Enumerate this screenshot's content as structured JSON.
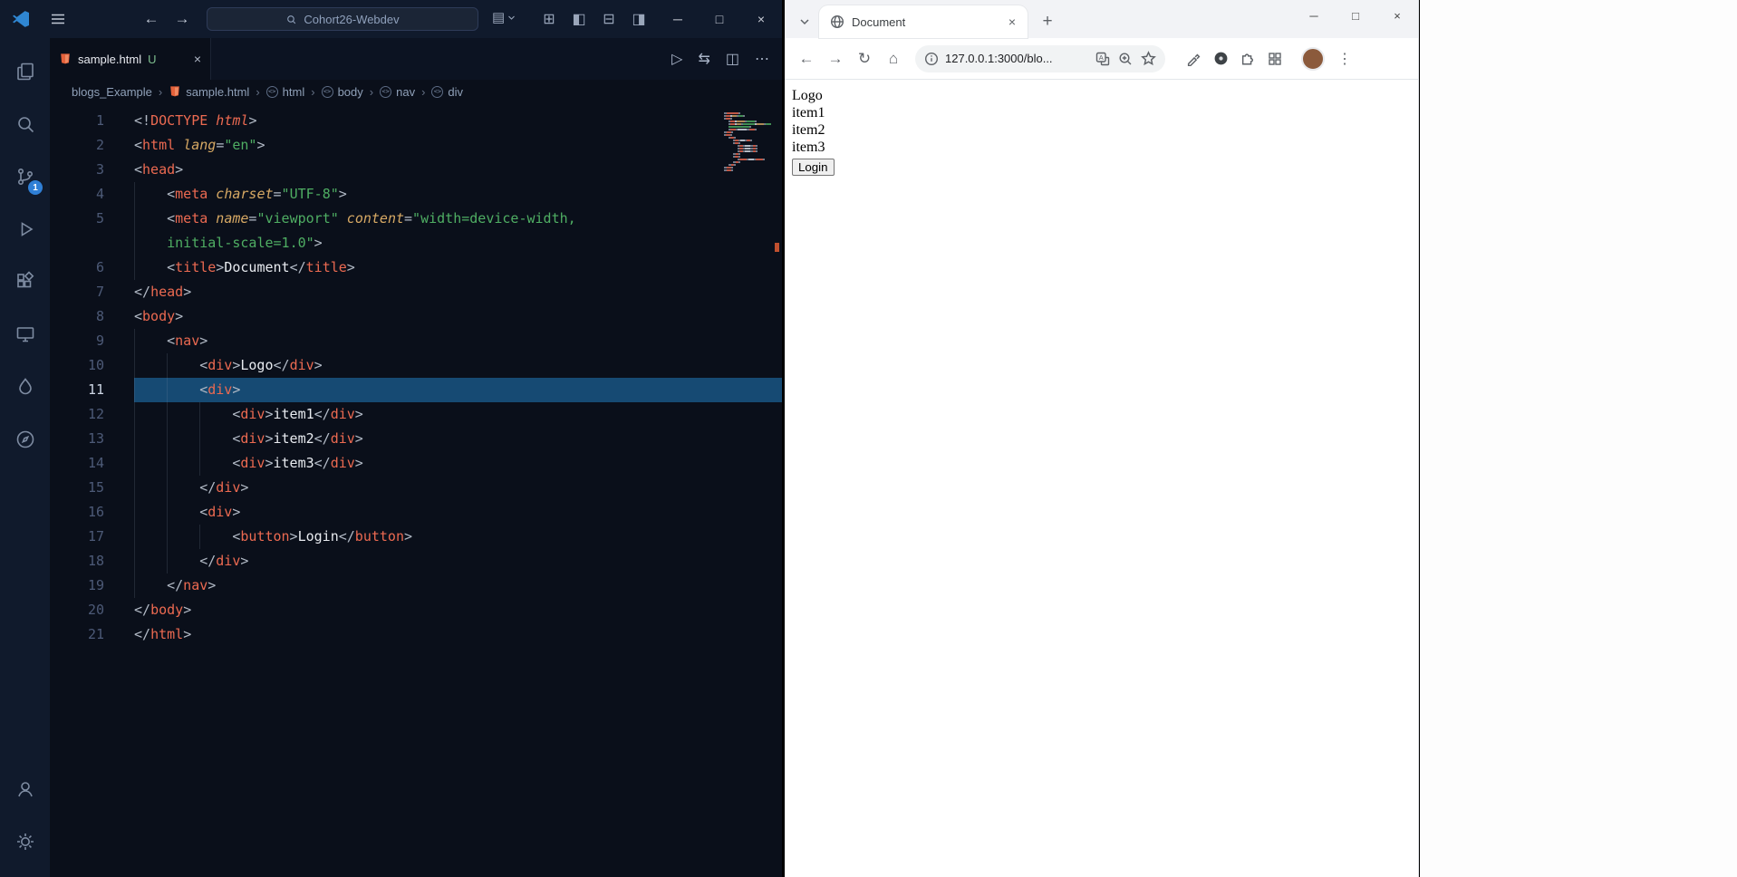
{
  "icons": {
    "play": "▷",
    "diff": "⇆",
    "split_editor": "◫",
    "more": "⋯",
    "minimize": "─",
    "maximize": "□",
    "close": "×",
    "back": "←",
    "forward": "→",
    "reload": "↻",
    "home": "⌂",
    "new_tab": "+",
    "menu_dots": "⋮",
    "grid_layout": "⊞",
    "panel_left": "◧",
    "panel_bottom": "⊟",
    "panel_right": "◨",
    "customize_layout": "▤",
    "breadcrumb_sep": "›"
  },
  "colors": {
    "accent_blue": "#2f86d2",
    "html_icon_orange": "#e5623b",
    "active_line_highlight": "#164a73",
    "tag": "#ec6a51",
    "attribute": "#d7a964",
    "string": "#4fae63",
    "badge_blue": "#2f7fd6"
  },
  "vscode": {
    "titlebar": {
      "search_placeholder": "Cohort26-Webdev"
    },
    "activitybar": {
      "source_control_badge": "1"
    },
    "tabs": [
      {
        "label": "sample.html",
        "status": "U"
      }
    ],
    "breadcrumb": [
      "blogs_Example",
      "sample.html",
      "html",
      "body",
      "nav",
      "div"
    ],
    "editor": {
      "active_line": 11,
      "lines": [
        {
          "n": "1",
          "ind": 0,
          "t": [
            [
              "p",
              "<!"
            ],
            [
              "t",
              "DOCTYPE"
            ],
            [
              "ti",
              " html"
            ],
            [
              "p",
              ">"
            ]
          ]
        },
        {
          "n": "2",
          "ind": 0,
          "t": [
            [
              "p",
              "<"
            ],
            [
              "t",
              "html"
            ],
            [
              "x",
              " "
            ],
            [
              "a",
              "lang"
            ],
            [
              "p",
              "="
            ],
            [
              "s",
              "\"en\""
            ],
            [
              "p",
              ">"
            ]
          ]
        },
        {
          "n": "3",
          "ind": 0,
          "t": [
            [
              "p",
              "<"
            ],
            [
              "t",
              "head"
            ],
            [
              "p",
              ">"
            ]
          ]
        },
        {
          "n": "4",
          "ind": 1,
          "t": [
            [
              "p",
              "<"
            ],
            [
              "t",
              "meta"
            ],
            [
              "x",
              " "
            ],
            [
              "a",
              "charset"
            ],
            [
              "p",
              "="
            ],
            [
              "s",
              "\"UTF-8\""
            ],
            [
              "p",
              ">"
            ]
          ]
        },
        {
          "n": "5",
          "ind": 1,
          "t": [
            [
              "p",
              "<"
            ],
            [
              "t",
              "meta"
            ],
            [
              "x",
              " "
            ],
            [
              "a",
              "name"
            ],
            [
              "p",
              "="
            ],
            [
              "s",
              "\"viewport\""
            ],
            [
              "x",
              " "
            ],
            [
              "a",
              "content"
            ],
            [
              "p",
              "="
            ],
            [
              "s",
              "\"width=device-width,"
            ]
          ]
        },
        {
          "n": "",
          "ind": 1,
          "t": [
            [
              "s",
              "initial-scale=1.0\""
            ],
            [
              "p",
              ">"
            ]
          ]
        },
        {
          "n": "6",
          "ind": 1,
          "t": [
            [
              "p",
              "<"
            ],
            [
              "t",
              "title"
            ],
            [
              "p",
              ">"
            ],
            [
              "x",
              "Document"
            ],
            [
              "p",
              "</"
            ],
            [
              "t",
              "title"
            ],
            [
              "p",
              ">"
            ]
          ]
        },
        {
          "n": "7",
          "ind": 0,
          "t": [
            [
              "p",
              "</"
            ],
            [
              "t",
              "head"
            ],
            [
              "p",
              ">"
            ]
          ]
        },
        {
          "n": "8",
          "ind": 0,
          "t": [
            [
              "p",
              "<"
            ],
            [
              "t",
              "body"
            ],
            [
              "p",
              ">"
            ]
          ]
        },
        {
          "n": "9",
          "ind": 1,
          "t": [
            [
              "p",
              "<"
            ],
            [
              "t",
              "nav"
            ],
            [
              "p",
              ">"
            ]
          ]
        },
        {
          "n": "10",
          "ind": 2,
          "t": [
            [
              "p",
              "<"
            ],
            [
              "t",
              "div"
            ],
            [
              "p",
              ">"
            ],
            [
              "x",
              "Logo"
            ],
            [
              "p",
              "</"
            ],
            [
              "t",
              "div"
            ],
            [
              "p",
              ">"
            ]
          ]
        },
        {
          "n": "11",
          "ind": 2,
          "active": true,
          "t": [
            [
              "p",
              "<"
            ],
            [
              "t",
              "div"
            ],
            [
              "p",
              ">"
            ]
          ]
        },
        {
          "n": "12",
          "ind": 3,
          "t": [
            [
              "p",
              "<"
            ],
            [
              "t",
              "div"
            ],
            [
              "p",
              ">"
            ],
            [
              "x",
              "item1"
            ],
            [
              "p",
              "</"
            ],
            [
              "t",
              "div"
            ],
            [
              "p",
              ">"
            ]
          ]
        },
        {
          "n": "13",
          "ind": 3,
          "t": [
            [
              "p",
              "<"
            ],
            [
              "t",
              "div"
            ],
            [
              "p",
              ">"
            ],
            [
              "x",
              "item2"
            ],
            [
              "p",
              "</"
            ],
            [
              "t",
              "div"
            ],
            [
              "p",
              ">"
            ]
          ]
        },
        {
          "n": "14",
          "ind": 3,
          "t": [
            [
              "p",
              "<"
            ],
            [
              "t",
              "div"
            ],
            [
              "p",
              ">"
            ],
            [
              "x",
              "item3"
            ],
            [
              "p",
              "</"
            ],
            [
              "t",
              "div"
            ],
            [
              "p",
              ">"
            ]
          ]
        },
        {
          "n": "15",
          "ind": 2,
          "t": [
            [
              "p",
              "</"
            ],
            [
              "t",
              "div"
            ],
            [
              "p",
              ">"
            ]
          ]
        },
        {
          "n": "16",
          "ind": 2,
          "t": [
            [
              "p",
              "<"
            ],
            [
              "t",
              "div"
            ],
            [
              "p",
              ">"
            ]
          ]
        },
        {
          "n": "17",
          "ind": 3,
          "t": [
            [
              "p",
              "<"
            ],
            [
              "t",
              "button"
            ],
            [
              "p",
              ">"
            ],
            [
              "x",
              "Login"
            ],
            [
              "p",
              "</"
            ],
            [
              "t",
              "button"
            ],
            [
              "p",
              ">"
            ]
          ]
        },
        {
          "n": "18",
          "ind": 2,
          "t": [
            [
              "p",
              "</"
            ],
            [
              "t",
              "div"
            ],
            [
              "p",
              ">"
            ]
          ]
        },
        {
          "n": "19",
          "ind": 1,
          "t": [
            [
              "p",
              "</"
            ],
            [
              "t",
              "nav"
            ],
            [
              "p",
              ">"
            ]
          ]
        },
        {
          "n": "20",
          "ind": 0,
          "t": [
            [
              "p",
              "</"
            ],
            [
              "t",
              "body"
            ],
            [
              "p",
              ">"
            ]
          ]
        },
        {
          "n": "21",
          "ind": 0,
          "t": [
            [
              "p",
              "</"
            ],
            [
              "t",
              "html"
            ],
            [
              "p",
              ">"
            ]
          ]
        }
      ]
    }
  },
  "browser": {
    "tab_title": "Document",
    "url": "127.0.0.1:3000/blo...",
    "page": {
      "texts": [
        "Logo",
        "item1",
        "item2",
        "item3"
      ],
      "button_label": "Login"
    }
  }
}
